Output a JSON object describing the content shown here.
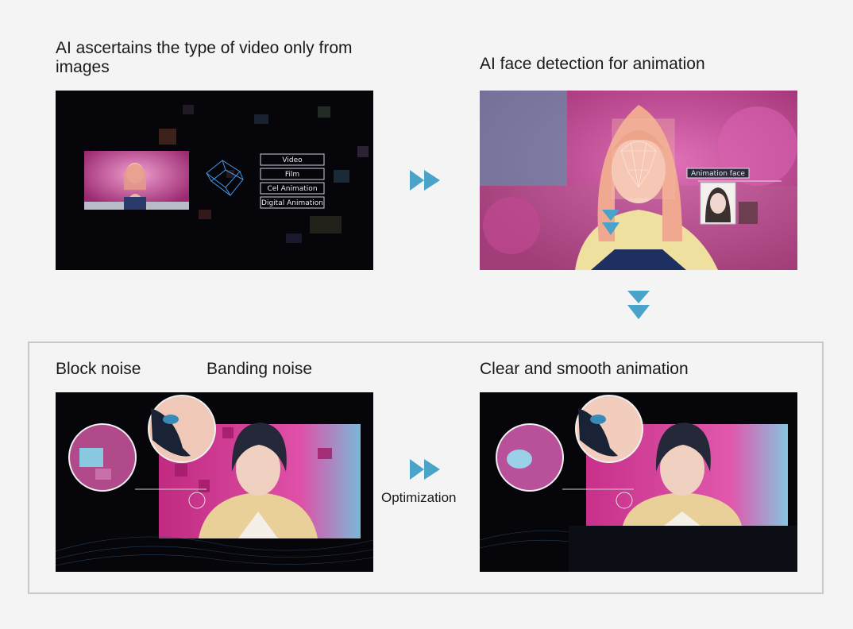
{
  "captions": {
    "step1": "AI ascertains the type of video only from images",
    "step2": "AI face detection for animation",
    "block_noise": "Block noise",
    "banding_noise": "Banding noise",
    "result": "Clear and smooth animation"
  },
  "optimization_label": "Optimization",
  "video_types": [
    "Video",
    "Film",
    "Cel Animation",
    "Digital Animation"
  ],
  "face_tag": "Animation face",
  "colors": {
    "arrow": "#4aa3c8",
    "frame": "#c9c9c9",
    "background": "#f4f4f4"
  }
}
